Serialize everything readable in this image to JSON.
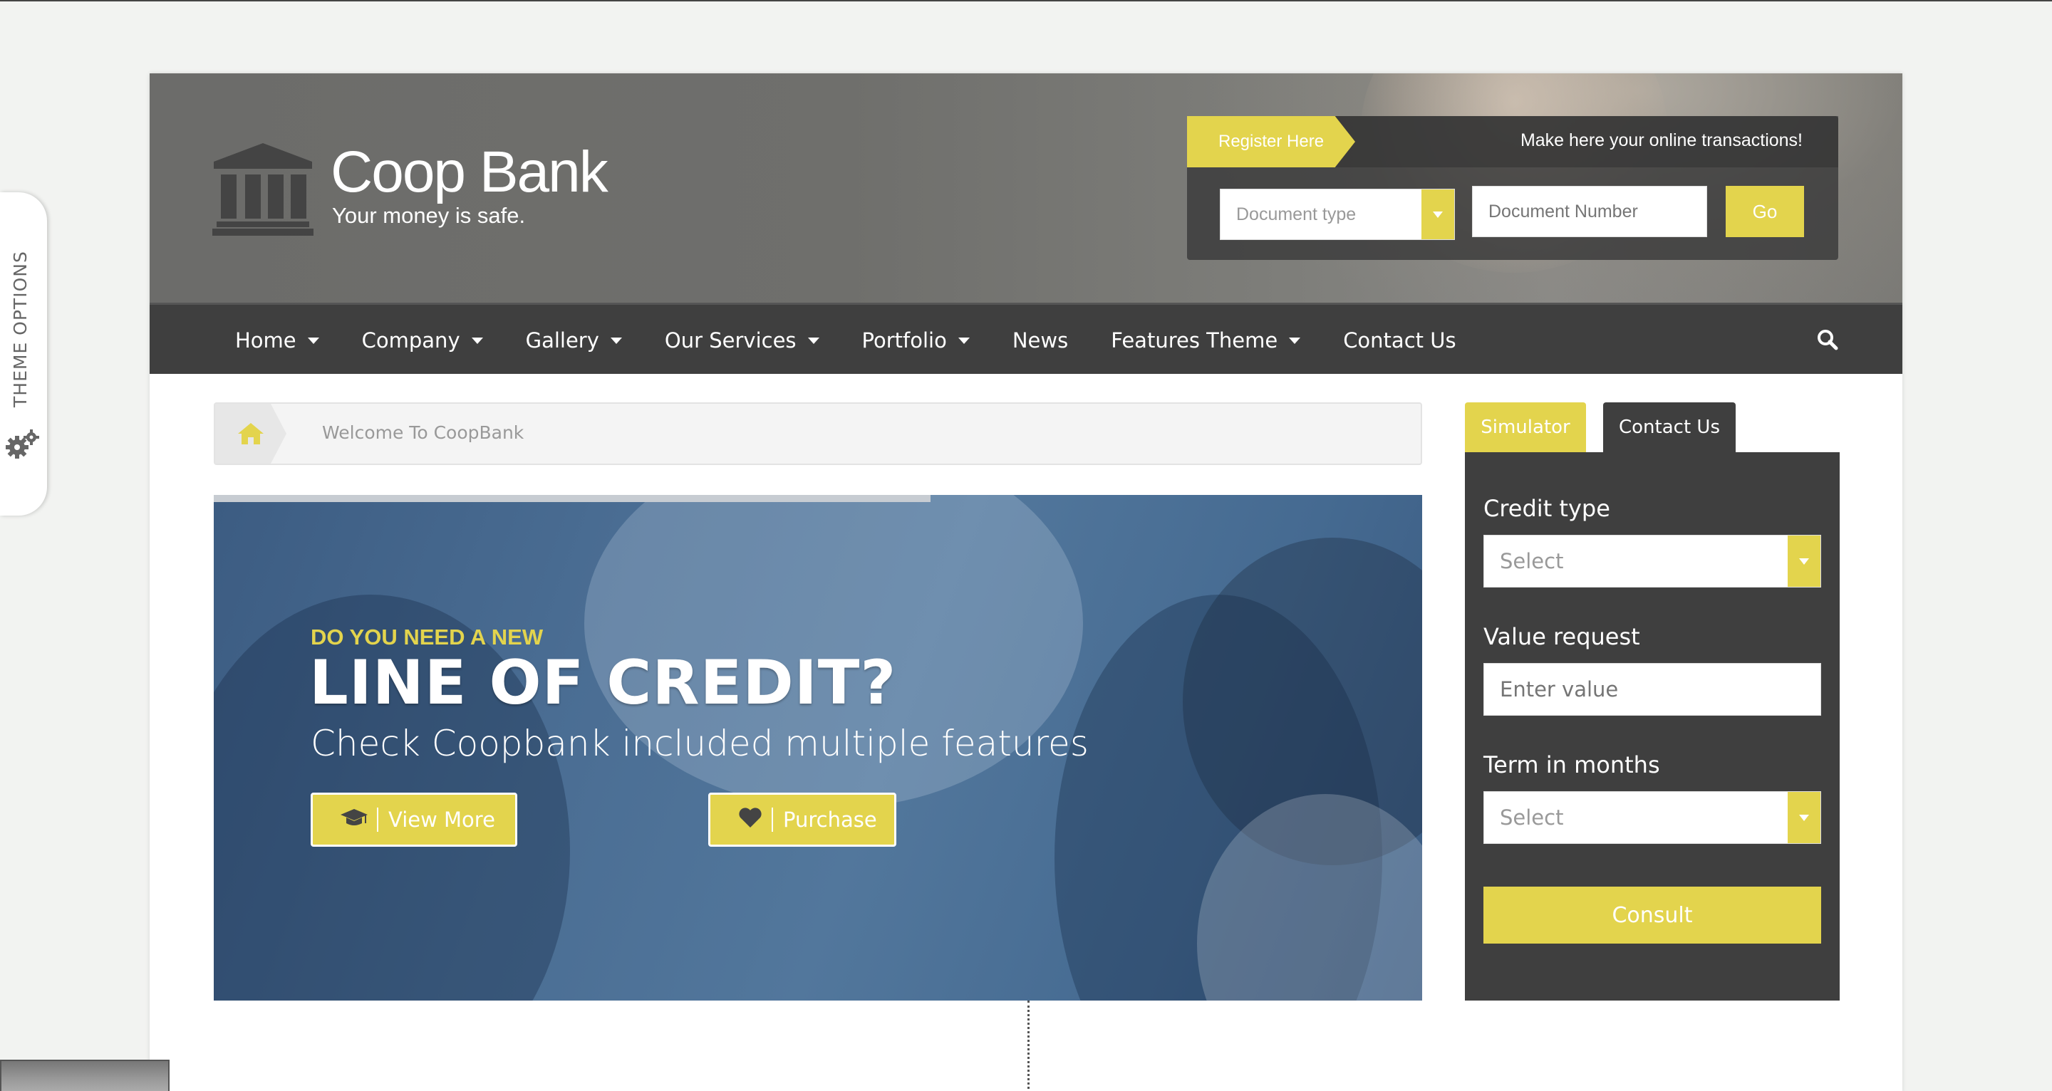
{
  "theme_options": {
    "label": "THEME OPTIONS",
    "icon": "gears-icon"
  },
  "brand": {
    "name": "Coop Bank",
    "tagline": "Your money is safe.",
    "logo_icon": "bank-building-icon"
  },
  "login": {
    "register_label": "Register Here",
    "message": "Make here your online transactions!",
    "document_type_placeholder": "Document type",
    "document_number_placeholder": "Document Number",
    "go_label": "Go"
  },
  "nav": {
    "items": [
      {
        "label": "Home",
        "dropdown": true
      },
      {
        "label": "Company",
        "dropdown": true
      },
      {
        "label": "Gallery",
        "dropdown": true
      },
      {
        "label": "Our Services",
        "dropdown": true
      },
      {
        "label": "Portfolio",
        "dropdown": true
      },
      {
        "label": "News",
        "dropdown": false
      },
      {
        "label": "Features Theme",
        "dropdown": true
      },
      {
        "label": "Contact Us",
        "dropdown": false
      }
    ],
    "search_icon": "search-icon"
  },
  "breadcrumb": {
    "home_icon": "home-icon",
    "text": "Welcome To CoopBank"
  },
  "hero": {
    "kicker": "DO YOU NEED A NEW",
    "title": "LINE OF CREDIT?",
    "subtitle": "Check Coopbank included multiple features",
    "view_more_label": "View More",
    "view_more_icon": "graduation-cap-icon",
    "purchase_label": "Purchase",
    "purchase_icon": "heart-icon"
  },
  "simulator": {
    "tabs": [
      "Simulator",
      "Contact Us"
    ],
    "credit_type_label": "Credit type",
    "credit_type_value": "Select",
    "value_request_label": "Value request",
    "value_request_placeholder": "Enter value",
    "term_label": "Term in months",
    "term_value": "Select",
    "consult_label": "Consult"
  },
  "colors": {
    "accent": "#e3d44d",
    "nav_bg": "#3f3f3f",
    "hero_blue": "#4a6d93",
    "white": "#ffffff"
  }
}
